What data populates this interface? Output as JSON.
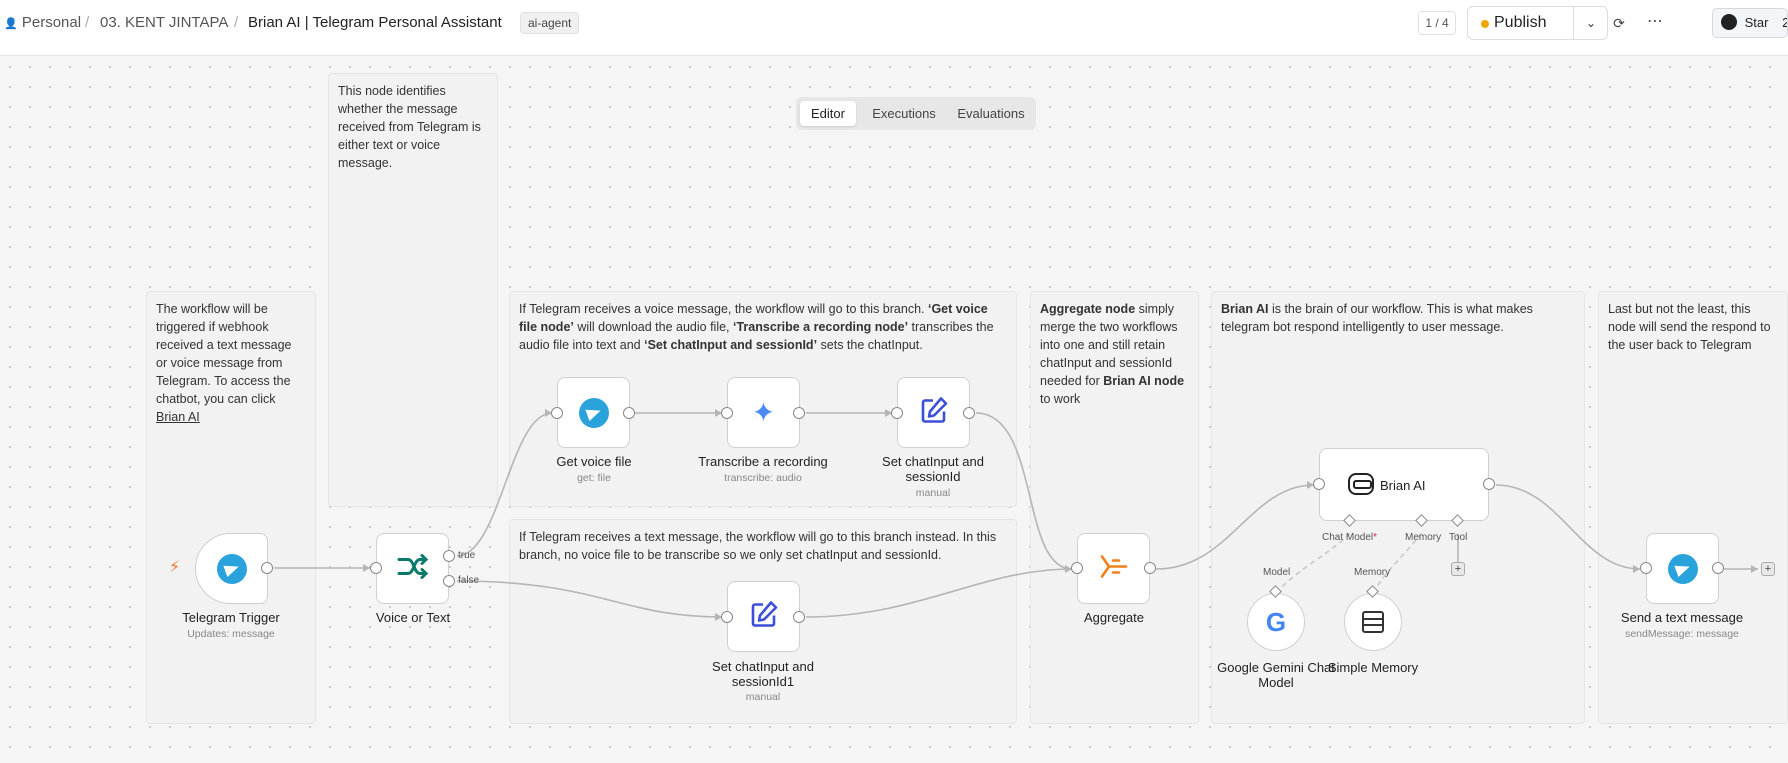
{
  "breadcrumb": {
    "owner": "Personal",
    "folder": "03. KENT JINTAPA",
    "workflow": "Brian AI | Telegram Personal Assistant",
    "separator": "/"
  },
  "tag": "ai-agent",
  "counter": "1 / 4",
  "publish": {
    "label": "Publish",
    "status_color": "#f0a500"
  },
  "github": {
    "label": "Star",
    "count": "2"
  },
  "tabs": [
    {
      "label": "Editor",
      "active": true
    },
    {
      "label": "Executions",
      "active": false
    },
    {
      "label": "Evaluations",
      "active": false
    }
  ],
  "notes": {
    "trigger": {
      "pre": "The workflow will be triggered if webhook received a text message or voice message from Telegram. To access the chatbot, you can click ",
      "link": "Brian AI"
    },
    "switch": "This node identifies whether the message received from Telegram is either text or voice message.",
    "voice": {
      "t1": "If Telegram receives a voice message, the workflow will go to this branch. ",
      "b1": "‘Get voice file node’",
      "t2": " will download the audio file, ",
      "b2": "‘Transcribe a recording node’",
      "t3": " transcribes the audio file into text and ",
      "b3": "‘Set chatInput and sessionId’",
      "t4": " sets the chatInput."
    },
    "text": "If Telegram receives a text message, the workflow will go to this branch instead. In this branch, no voice file to be transcribe so we only set chatInput and sessionId.",
    "aggregate": {
      "b1": "Aggregate node",
      "t1": " simply merge the two workflows into one and still retain chatInput and sessionId needed for ",
      "b2": "Brian AI node",
      "t2": " to work"
    },
    "agent": {
      "b1": "Brian AI",
      "t1": " is the brain of our workflow. This is what makes telegram bot respond intelligently to user message."
    },
    "send": "Last but not the least, this node will send the respond to the user back to Telegram"
  },
  "nodes": {
    "telegram_trigger": {
      "label": "Telegram Trigger",
      "sub": "Updates: message"
    },
    "voice_or_text": {
      "label": "Voice or Text",
      "out_true": "true",
      "out_false": "false"
    },
    "get_voice_file": {
      "label": "Get voice file",
      "sub": "get: file"
    },
    "transcribe": {
      "label": "Transcribe a recording",
      "sub": "transcribe: audio"
    },
    "set_chat": {
      "label": "Set chatInput and sessionId",
      "sub": "manual"
    },
    "set_chat1": {
      "label": "Set chatInput and sessionId1",
      "sub": "manual"
    },
    "aggregate": {
      "label": "Aggregate"
    },
    "brian_ai": {
      "label": "Brian AI",
      "pin_model": "Chat Model",
      "pin_required": "*",
      "pin_memory": "Memory",
      "pin_tool": "Tool"
    },
    "gemini": {
      "label": "Google Gemini Chat Model",
      "pin": "Model"
    },
    "memory": {
      "label": "Simple Memory",
      "pin": "Memory"
    },
    "send_message": {
      "label": "Send a text message",
      "sub": "sendMessage: message"
    }
  }
}
